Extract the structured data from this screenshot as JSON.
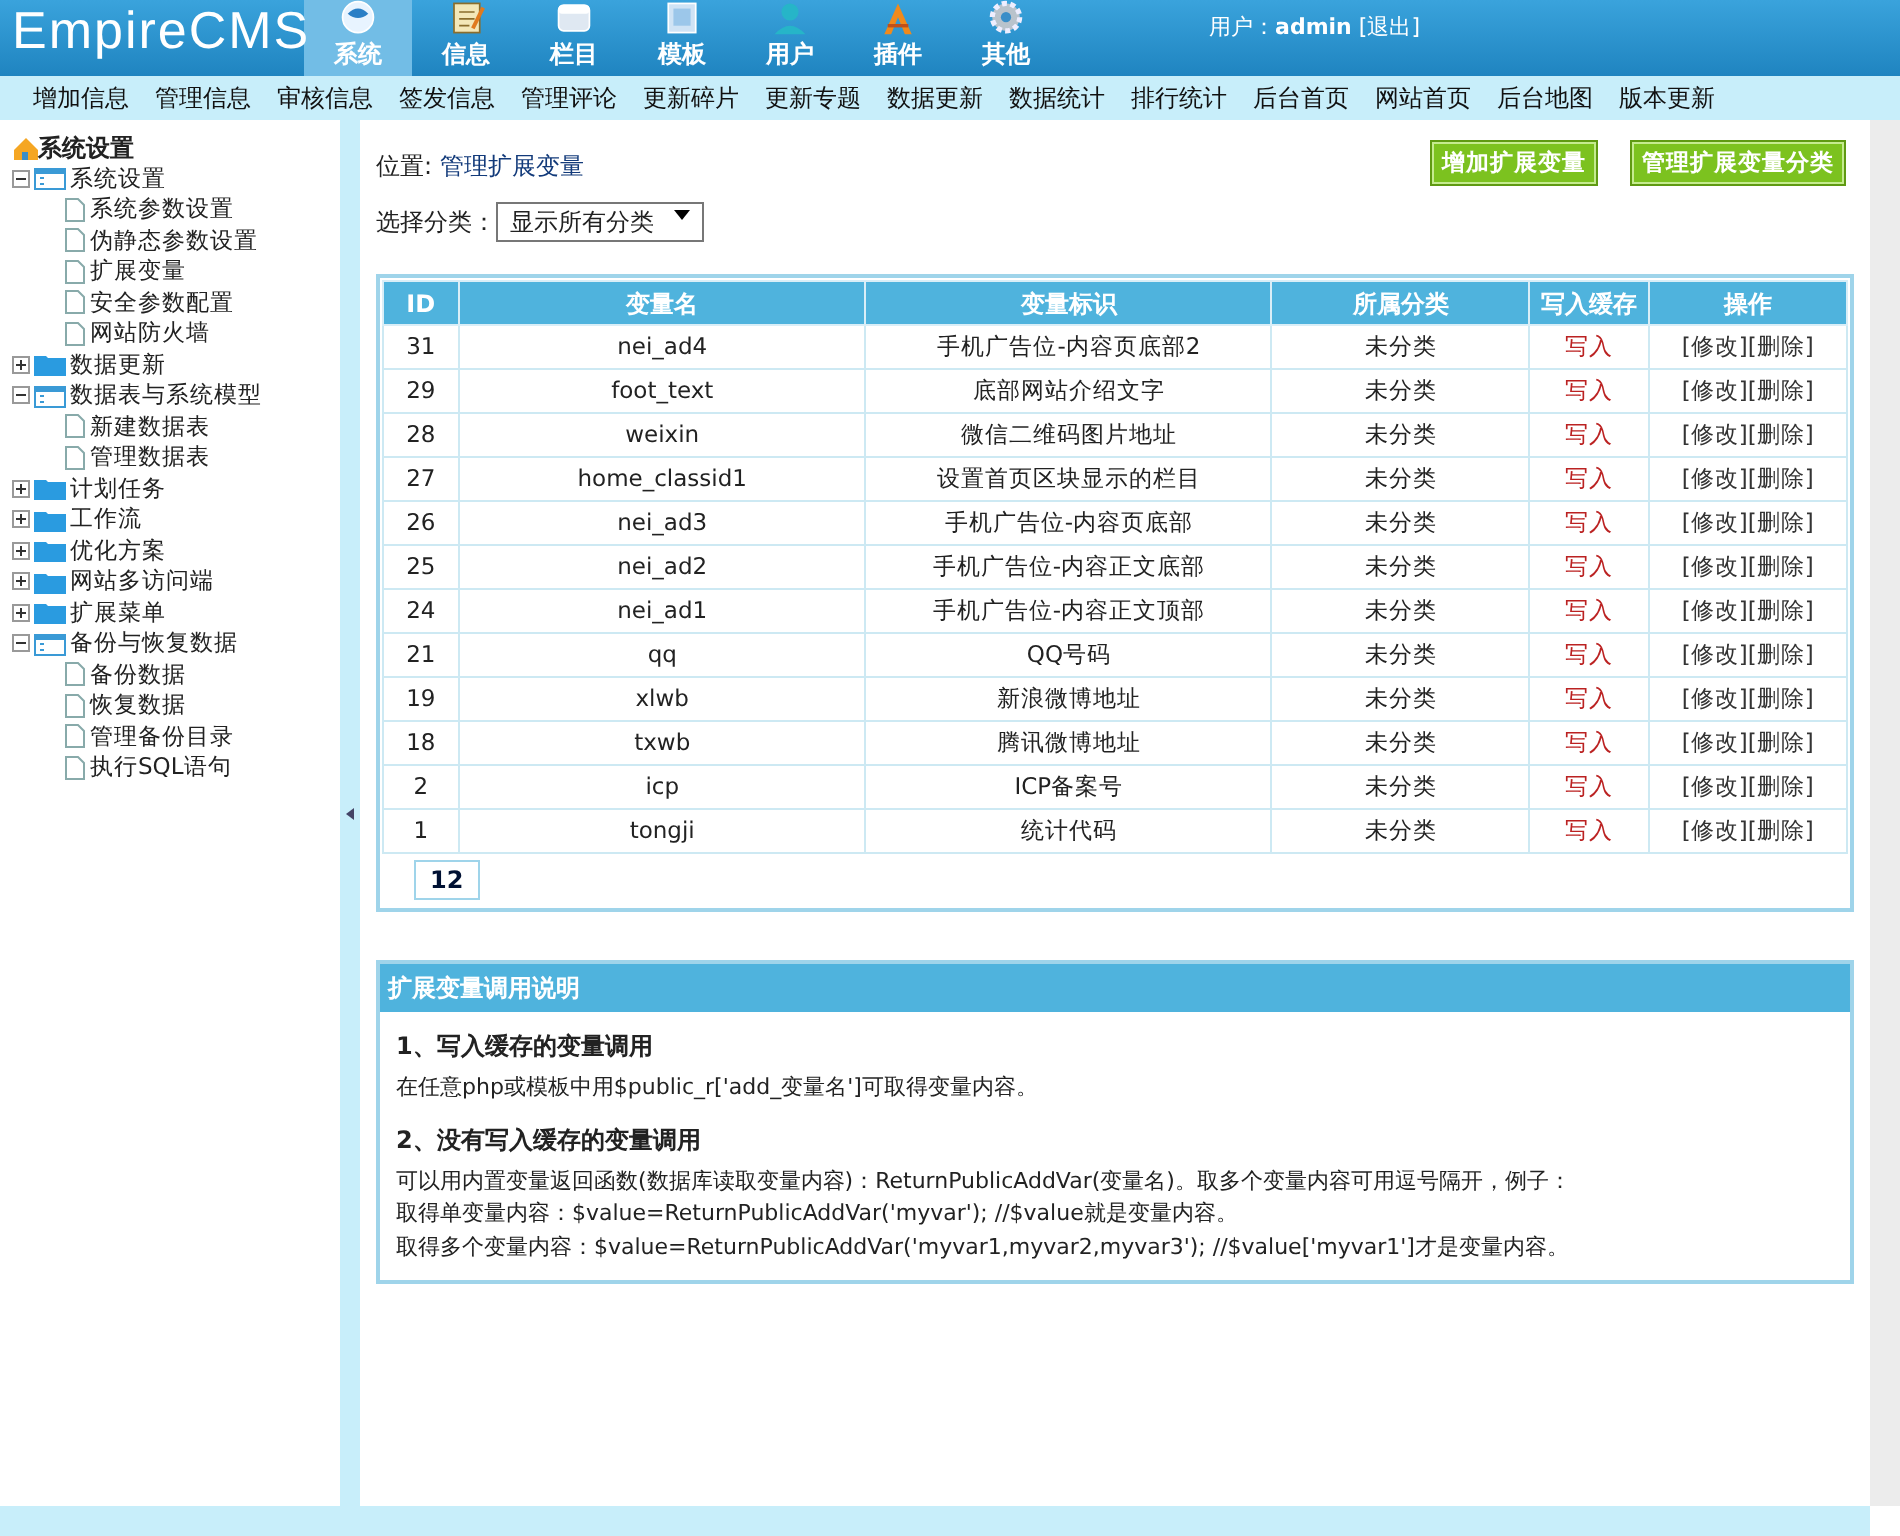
{
  "header": {
    "logo": "EmpireCMS",
    "nav": [
      {
        "label": "系统",
        "selected": true
      },
      {
        "label": "信息",
        "selected": false
      },
      {
        "label": "栏目",
        "selected": false
      },
      {
        "label": "模板",
        "selected": false
      },
      {
        "label": "用户",
        "selected": false
      },
      {
        "label": "插件",
        "selected": false
      },
      {
        "label": "其他",
        "selected": false
      }
    ],
    "user_label": "用户：",
    "user": "admin",
    "logout": "[退出]"
  },
  "menu": [
    "增加信息",
    "管理信息",
    "审核信息",
    "签发信息",
    "管理评论",
    "更新碎片",
    "更新专题",
    "数据更新",
    "数据统计",
    "排行统计",
    "后台首页",
    "网站首页",
    "后台地图",
    "版本更新"
  ],
  "sidebar": {
    "title": "系统设置",
    "tree": [
      {
        "label": "系统设置",
        "expanded": true,
        "children": [
          {
            "label": "系统参数设置"
          },
          {
            "label": "伪静态参数设置"
          },
          {
            "label": "扩展变量"
          },
          {
            "label": "安全参数配置"
          },
          {
            "label": "网站防火墙"
          }
        ]
      },
      {
        "label": "数据更新",
        "expanded": false
      },
      {
        "label": "数据表与系统模型",
        "expanded": true,
        "children": [
          {
            "label": "新建数据表"
          },
          {
            "label": "管理数据表"
          }
        ]
      },
      {
        "label": "计划任务",
        "expanded": false
      },
      {
        "label": "工作流",
        "expanded": false
      },
      {
        "label": "优化方案",
        "expanded": false
      },
      {
        "label": "网站多访问端",
        "expanded": false
      },
      {
        "label": "扩展菜单",
        "expanded": false
      },
      {
        "label": "备份与恢复数据",
        "expanded": true,
        "children": [
          {
            "label": "备份数据"
          },
          {
            "label": "恢复数据"
          },
          {
            "label": "管理备份目录"
          },
          {
            "label": "执行SQL语句"
          }
        ]
      }
    ]
  },
  "location": {
    "label": "位置:",
    "link": "管理扩展变量"
  },
  "buttons": [
    "增加扩展变量",
    "管理扩展变量分类"
  ],
  "filter": {
    "label": "选择分类：",
    "value": "显示所有分类"
  },
  "table": {
    "columns": [
      "ID",
      "变量名",
      "变量标识",
      "所属分类",
      "写入缓存",
      "操作"
    ],
    "rows": [
      [
        "31",
        "nei_ad4",
        "手机广告位-内容页底部2",
        "未分类",
        "写入",
        "[修改]",
        "[删除]"
      ],
      [
        "29",
        "foot_text",
        "底部网站介绍文字",
        "未分类",
        "写入",
        "[修改]",
        "[删除]"
      ],
      [
        "28",
        "weixin",
        "微信二维码图片地址",
        "未分类",
        "写入",
        "[修改]",
        "[删除]"
      ],
      [
        "27",
        "home_classid1",
        "设置首页区块显示的栏目",
        "未分类",
        "写入",
        "[修改]",
        "[删除]"
      ],
      [
        "26",
        "nei_ad3",
        "手机广告位-内容页底部",
        "未分类",
        "写入",
        "[修改]",
        "[删除]"
      ],
      [
        "25",
        "nei_ad2",
        "手机广告位-内容正文底部",
        "未分类",
        "写入",
        "[修改]",
        "[删除]"
      ],
      [
        "24",
        "nei_ad1",
        "手机广告位-内容正文顶部",
        "未分类",
        "写入",
        "[修改]",
        "[删除]"
      ],
      [
        "21",
        "qq",
        "QQ号码",
        "未分类",
        "写入",
        "[修改]",
        "[删除]"
      ],
      [
        "19",
        "xlwb",
        "新浪微博地址",
        "未分类",
        "写入",
        "[修改]",
        "[删除]"
      ],
      [
        "18",
        "txwb",
        "腾讯微博地址",
        "未分类",
        "写入",
        "[修改]",
        "[删除]"
      ],
      [
        "2",
        "icp",
        "ICP备案号",
        "未分类",
        "写入",
        "[修改]",
        "[删除]"
      ],
      [
        "1",
        "tongji",
        "统计代码",
        "未分类",
        "写入",
        "[修改]",
        "[删除]"
      ]
    ],
    "pagination": "12"
  },
  "help": {
    "title": "扩展变量调用说明",
    "sections": [
      {
        "heading": "1、写入缓存的变量调用",
        "lines": [
          "在任意php或模板中用$public_r['add_变量名']可取得变量内容。"
        ]
      },
      {
        "heading": "2、没有写入缓存的变量调用",
        "lines": [
          "可以用内置变量返回函数(数据库读取变量内容)：ReturnPublicAddVar(变量名)。取多个变量内容可用逗号隔开，例子：",
          "取得单变量内容：$value=ReturnPublicAddVar('myvar'); //$value就是变量内容。",
          "取得多个变量内容：$value=ReturnPublicAddVar('myvar1,myvar2,myvar3'); //$value['myvar1']才是变量内容。"
        ]
      }
    ]
  }
}
